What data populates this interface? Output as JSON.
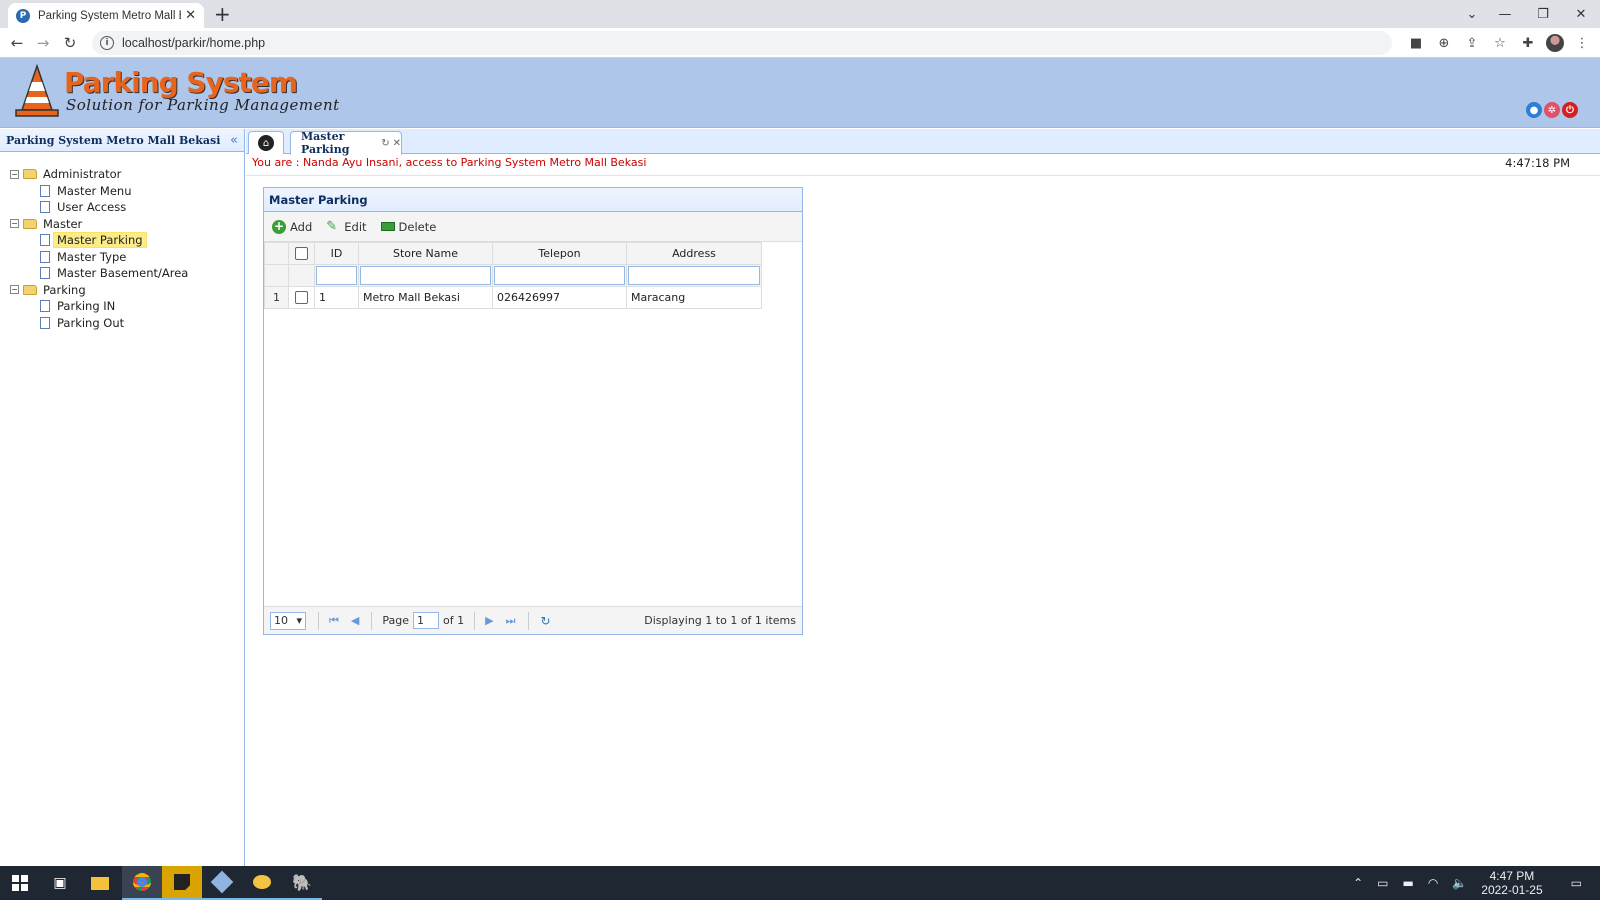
{
  "browser": {
    "tab_title": "Parking System Metro Mall Bekasi",
    "url": "localhost/parkir/home.php"
  },
  "header": {
    "logo_title": "Parking System",
    "logo_subtitle": "Solution for Parking Management"
  },
  "sidebar": {
    "title": "Parking System Metro Mall Bekasi",
    "tree": [
      {
        "label": "Administrator",
        "children": [
          "Master Menu",
          "User Access"
        ]
      },
      {
        "label": "Master",
        "children": [
          "Master Parking",
          "Master Type",
          "Master Basement/Area"
        ]
      },
      {
        "label": "Parking",
        "children": [
          "Parking IN",
          "Parking Out"
        ]
      }
    ],
    "selected": "Master Parking"
  },
  "main": {
    "tab_label": "Master Parking",
    "user_info": "You are : Nanda Ayu Insani, access to Parking System Metro Mall Bekasi",
    "clock": "4:47:18 PM"
  },
  "panel": {
    "title": "Master Parking",
    "toolbar": {
      "add": "Add",
      "edit": "Edit",
      "delete": "Delete"
    },
    "columns": [
      "ID",
      "Store Name",
      "Telepon",
      "Address"
    ],
    "rows": [
      {
        "row_number": "1",
        "id": "1",
        "store_name": "Metro Mall Bekasi",
        "telepon": "026426997",
        "address": "Maracang"
      }
    ],
    "pager": {
      "page_size": "10",
      "page_label": "Page",
      "page_value": "1",
      "of_label": "of 1",
      "display_text": "Displaying 1 to 1 of 1 items"
    }
  },
  "taskbar": {
    "time": "4:47 PM",
    "date": "2022-01-25"
  },
  "colors": {
    "header_bg": "#aec6ea",
    "border_blue": "#95b8e7",
    "accent_orange": "#e8631b",
    "user_red": "#cc0000"
  }
}
